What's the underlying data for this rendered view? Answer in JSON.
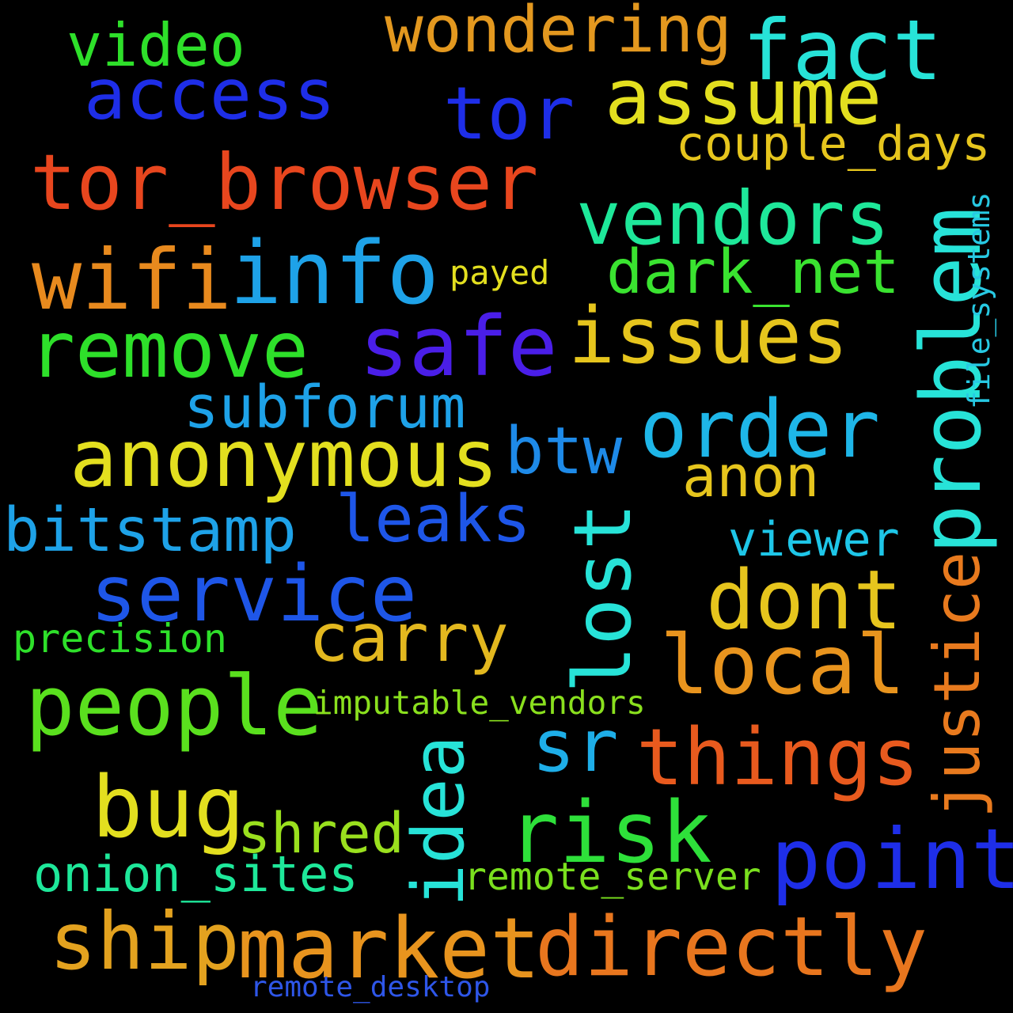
{
  "words": [
    {
      "text": "tor_browser",
      "color": "#e8461e"
    },
    {
      "text": "wondering",
      "color": "#e3981f"
    },
    {
      "text": "fact",
      "color": "#27e3d8"
    },
    {
      "text": "video",
      "color": "#2ee02a"
    },
    {
      "text": "access",
      "color": "#1e2ee8"
    },
    {
      "text": "tor",
      "color": "#1e2ee8"
    },
    {
      "text": "assume",
      "color": "#e3df1f"
    },
    {
      "text": "couple_days",
      "color": "#e6c51d"
    },
    {
      "text": "vendors",
      "color": "#1ee89a"
    },
    {
      "text": "wifi",
      "color": "#e88a1e"
    },
    {
      "text": "info",
      "color": "#1ea2e8"
    },
    {
      "text": "payed",
      "color": "#e3df1f"
    },
    {
      "text": "dark_net",
      "color": "#3ae330"
    },
    {
      "text": "problem",
      "color": "#27e3d8"
    },
    {
      "text": "file_systems",
      "color": "#27c9e3"
    },
    {
      "text": "remove",
      "color": "#2ee02a"
    },
    {
      "text": "safe",
      "color": "#4a1ee8"
    },
    {
      "text": "issues",
      "color": "#e6c51d"
    },
    {
      "text": "subforum",
      "color": "#1ea2e8"
    },
    {
      "text": "order",
      "color": "#1eb6e8"
    },
    {
      "text": "anonymous",
      "color": "#e3df1f"
    },
    {
      "text": "btw",
      "color": "#1e8ae8"
    },
    {
      "text": "anon",
      "color": "#e6c51d"
    },
    {
      "text": "bitstamp",
      "color": "#1ea2e8"
    },
    {
      "text": "leaks",
      "color": "#1e56e8"
    },
    {
      "text": "lost",
      "color": "#27e3d8"
    },
    {
      "text": "viewer",
      "color": "#1ec6e8"
    },
    {
      "text": "justice",
      "color": "#e87a1e"
    },
    {
      "text": "service",
      "color": "#1e56e8"
    },
    {
      "text": "dont",
      "color": "#e6c51d"
    },
    {
      "text": "precision",
      "color": "#2ee02a"
    },
    {
      "text": "carry",
      "color": "#e3b81f"
    },
    {
      "text": "local",
      "color": "#e8941e"
    },
    {
      "text": "people",
      "color": "#5ae01e"
    },
    {
      "text": "imputable_vendors",
      "color": "#8ae01e"
    },
    {
      "text": "idea",
      "color": "#27e3d8"
    },
    {
      "text": "sr",
      "color": "#1eaee8"
    },
    {
      "text": "things",
      "color": "#e85a1e"
    },
    {
      "text": "bug",
      "color": "#e3df1f"
    },
    {
      "text": "shred",
      "color": "#9ae01e"
    },
    {
      "text": "risk",
      "color": "#2ee03a"
    },
    {
      "text": "point",
      "color": "#1e2ee8"
    },
    {
      "text": "onion_sites",
      "color": "#1ee89a"
    },
    {
      "text": "remote_server",
      "color": "#7ae01e"
    },
    {
      "text": "ship",
      "color": "#e3a21f"
    },
    {
      "text": "market",
      "color": "#e8941e"
    },
    {
      "text": "directly",
      "color": "#e8761e"
    },
    {
      "text": "remote_desktop",
      "color": "#2e56e8"
    }
  ]
}
